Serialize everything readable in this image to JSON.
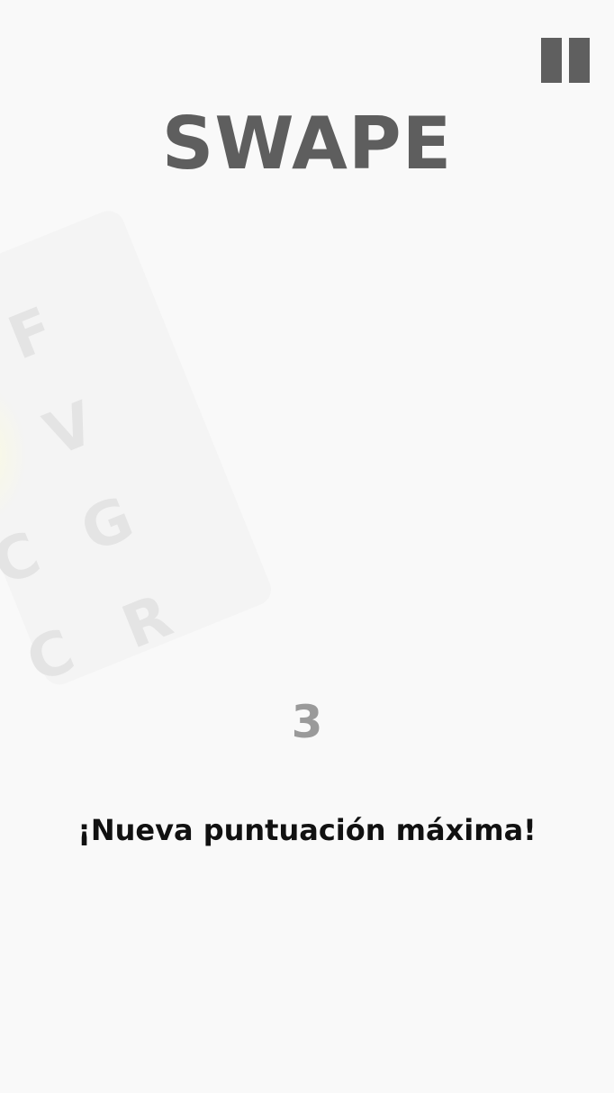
{
  "game": {
    "title": "SWAPE",
    "score": "3",
    "message": "¡Nueva puntuación máxima!"
  },
  "board": {
    "letters": [
      "F",
      "V",
      "C",
      "G",
      "C",
      "R"
    ]
  },
  "controls": {
    "pause_icon": "pause-icon"
  },
  "colors": {
    "background": "#f9f9f9",
    "title": "#5e5e5e",
    "pause": "#5f5f5f",
    "score": "#9a9a9a",
    "message": "#111111",
    "board_letters": "#e4e4e4"
  }
}
